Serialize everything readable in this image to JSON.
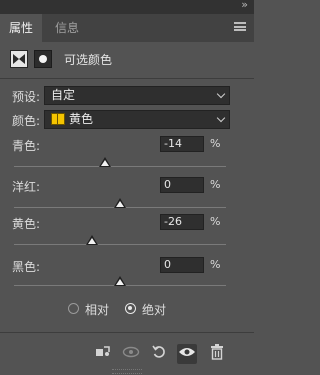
{
  "window": {
    "collapse_glyph": "»"
  },
  "tabs": [
    {
      "label": "属性",
      "active": true
    },
    {
      "label": "信息",
      "active": false
    }
  ],
  "adjustment": {
    "title": "可选颜色",
    "icons": [
      "selective-color-icon",
      "mask-icon"
    ]
  },
  "preset": {
    "label": "预设:",
    "value": "自定"
  },
  "colors": {
    "label": "颜色:",
    "value": "黄色",
    "swatch_color": "#f5c400"
  },
  "sliders": [
    {
      "label": "青色:",
      "value": "-14",
      "unit": "%",
      "numeric": -14
    },
    {
      "label": "洋红:",
      "value": "0",
      "unit": "%",
      "numeric": 0
    },
    {
      "label": "黄色:",
      "value": "-26",
      "unit": "%",
      "numeric": -26
    },
    {
      "label": "黑色:",
      "value": "0",
      "unit": "%",
      "numeric": 0
    }
  ],
  "method": {
    "options": [
      {
        "label": "相对",
        "checked": false
      },
      {
        "label": "绝对",
        "checked": true
      }
    ]
  },
  "bottom_icons": [
    "clip-to-layer-icon",
    "view-previous-icon",
    "reset-icon",
    "visibility-eye-icon",
    "trash-icon"
  ],
  "accent_colors": {
    "background": "#535353",
    "field": "#2f2f2f"
  }
}
